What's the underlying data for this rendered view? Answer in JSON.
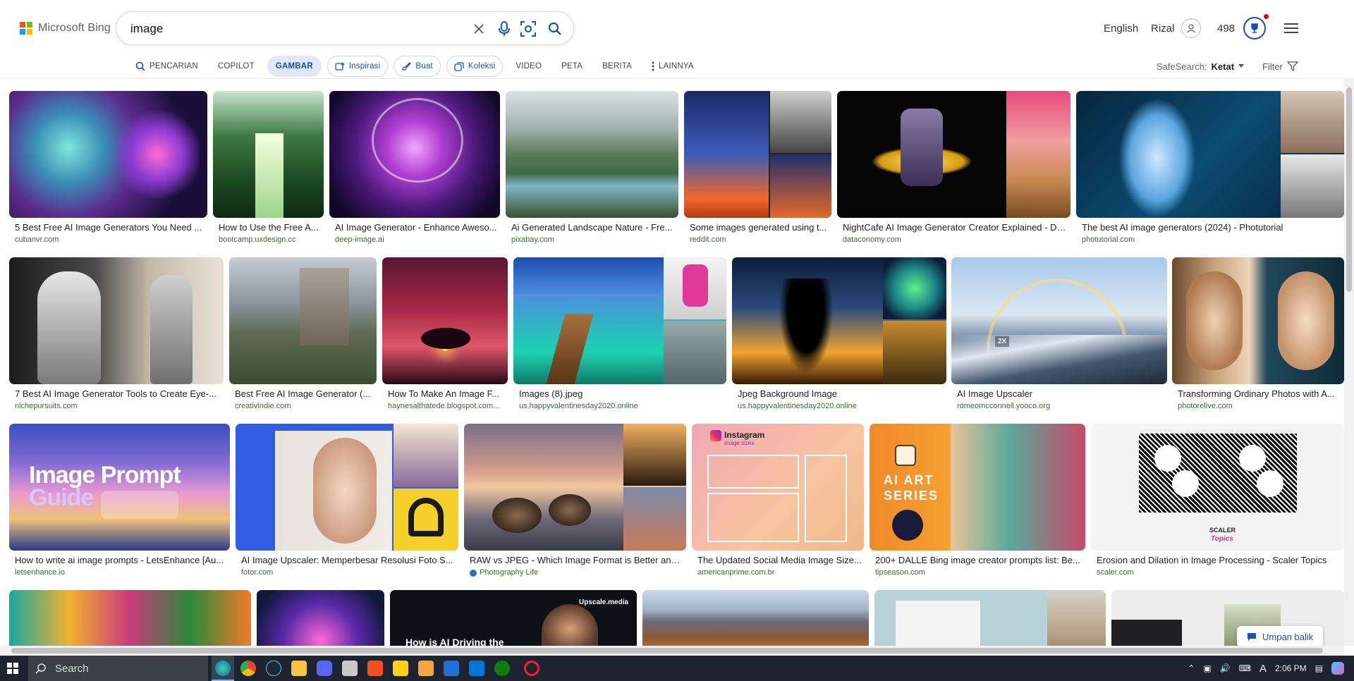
{
  "header": {
    "logo_text": "Microsoft Bing",
    "search_value": "image",
    "language": "English",
    "user_name": "Rizal",
    "reward_points": "498"
  },
  "tabs": [
    {
      "label": "PENCARIAN",
      "icon": "search-icon"
    },
    {
      "label": "COPILOT"
    },
    {
      "label": "GAMBAR",
      "active": true
    },
    {
      "label": "Inspirasi",
      "icon": "sparkle-icon"
    },
    {
      "label": "Buat",
      "icon": "brush-icon"
    },
    {
      "label": "Koleksi",
      "icon": "collection-icon"
    },
    {
      "label": "VIDEO"
    },
    {
      "label": "PETA"
    },
    {
      "label": "BERITA"
    },
    {
      "label": "LAINNYA",
      "icon": "more-vertical-icon"
    }
  ],
  "safesearch": {
    "label": "SafeSearch:",
    "value": "Ketat"
  },
  "filter_label": "Filter",
  "results": [
    {
      "caption": "5 Best Free AI Image Generators You Need ...",
      "domain": "cubanvr.com"
    },
    {
      "caption": "How to Use the Free A...",
      "domain": "bootcamp.uxdesign.cc"
    },
    {
      "caption": "AI Image Generator - Enhance Aweso...",
      "domain": "deep-image.ai"
    },
    {
      "caption": "Ai Generated Landscape Nature - Fre...",
      "domain": "pixabay.com"
    },
    {
      "caption": "Some images generated using t...",
      "domain": "reddit.com"
    },
    {
      "caption": "NightCafe AI Image Generator Creator Explained - Da...",
      "domain": "dataconomy.com"
    },
    {
      "caption": "The best AI image generators (2024) - Photutorial",
      "domain": "photutorial.com"
    },
    {
      "caption": "7 Best AI Image Generator Tools to Create Eye-...",
      "domain": "nichepursuits.com"
    },
    {
      "caption": "Best Free AI Image Generator (...",
      "domain": "creativindie.com"
    },
    {
      "caption": "How To Make An Image F...",
      "domain": "haynesalthatede.blogspot.com..."
    },
    {
      "caption": "Images (8).jpeg",
      "domain": "us.happyvalentinesday2020.online"
    },
    {
      "caption": "Jpeg Background Image",
      "domain": "us.happyvalentinesday2020.online"
    },
    {
      "caption": "AI Image Upscaler",
      "domain": "romeomcconnell.yooco.org"
    },
    {
      "caption": "Transforming Ordinary Photos with A...",
      "domain": "photorelive.com"
    },
    {
      "caption": "How to write ai image prompts - LetsEnhance [Au...",
      "domain": "letsenhance.io"
    },
    {
      "caption": "AI Image Upscaler: Memperbesar Resolusi Foto S...",
      "domain": "fotor.com"
    },
    {
      "caption": "RAW vs JPEG - Which Image Format is Better and ...",
      "domain": "Photography Life"
    },
    {
      "caption": "The Updated Social Media Image Size...",
      "domain": "americanprime.com.br"
    },
    {
      "caption": "200+ DALLE Bing image creator prompts list: Be...",
      "domain": "tipseason.com"
    },
    {
      "caption": "Erosion and Dilation in Image Processing - Scaler Topics",
      "domain": "scaler.com"
    }
  ],
  "overlays": {
    "prompt_guide_1": "Image Prompt",
    "prompt_guide_2": "Guide",
    "upscaler_badge": "2X",
    "instagram_title": "Instagram",
    "instagram_sub": "image sizes",
    "ai_art_1": "AI ART",
    "ai_art_2": "SERIES",
    "scaler_1": "SCALER",
    "scaler_2": "Topics",
    "upscale_media": "Upscale.media",
    "how_is": "How is AI Driving the"
  },
  "feedback_label": "Umpan balik",
  "taskbar": {
    "search_label": "Search",
    "time": "2:06 PM"
  },
  "colors": {
    "accent": "#1a51b4",
    "tab_active_bg": "#dfe9fb",
    "taskbar": "#1d2430"
  }
}
